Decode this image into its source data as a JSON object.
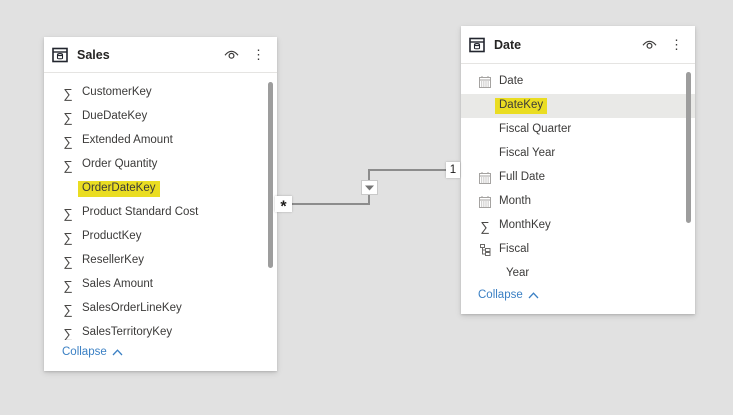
{
  "colors": {
    "background": "#e1e1e1",
    "card": "#ffffff",
    "highlight_yellow": "#eadd22",
    "selected_row_gray": "#e9e9e7",
    "link_blue": "#3b80c4",
    "relationship_line": "#8c8c8c"
  },
  "relationship": {
    "many_label": "*",
    "one_label": "1",
    "direction_icon": "filter-arrow-down"
  },
  "tables": [
    {
      "name": "Sales",
      "collapse_label": "Collapse",
      "fields": [
        {
          "label": "CustomerKey",
          "icon": "sigma"
        },
        {
          "label": "DueDateKey",
          "icon": "sigma"
        },
        {
          "label": "Extended Amount",
          "icon": "sigma"
        },
        {
          "label": "Order Quantity",
          "icon": "sigma"
        },
        {
          "label": "OrderDateKey",
          "icon": "none",
          "highlighted": true
        },
        {
          "label": "Product Standard Cost",
          "icon": "sigma"
        },
        {
          "label": "ProductKey",
          "icon": "sigma"
        },
        {
          "label": "ResellerKey",
          "icon": "sigma"
        },
        {
          "label": "Sales Amount",
          "icon": "sigma"
        },
        {
          "label": "SalesOrderLineKey",
          "icon": "sigma"
        },
        {
          "label": "SalesTerritoryKey",
          "icon": "sigma"
        }
      ]
    },
    {
      "name": "Date",
      "collapse_label": "Collapse",
      "fields": [
        {
          "label": "Date",
          "icon": "calendar"
        },
        {
          "label": "DateKey",
          "icon": "none",
          "highlighted": true,
          "selected": true
        },
        {
          "label": "Fiscal Quarter",
          "icon": "none"
        },
        {
          "label": "Fiscal Year",
          "icon": "none"
        },
        {
          "label": "Full Date",
          "icon": "calendar"
        },
        {
          "label": "Month",
          "icon": "calendar"
        },
        {
          "label": "MonthKey",
          "icon": "sigma"
        },
        {
          "label": "Fiscal",
          "icon": "hierarchy"
        },
        {
          "label": "Year",
          "icon": "none",
          "indent": 1
        }
      ]
    }
  ]
}
